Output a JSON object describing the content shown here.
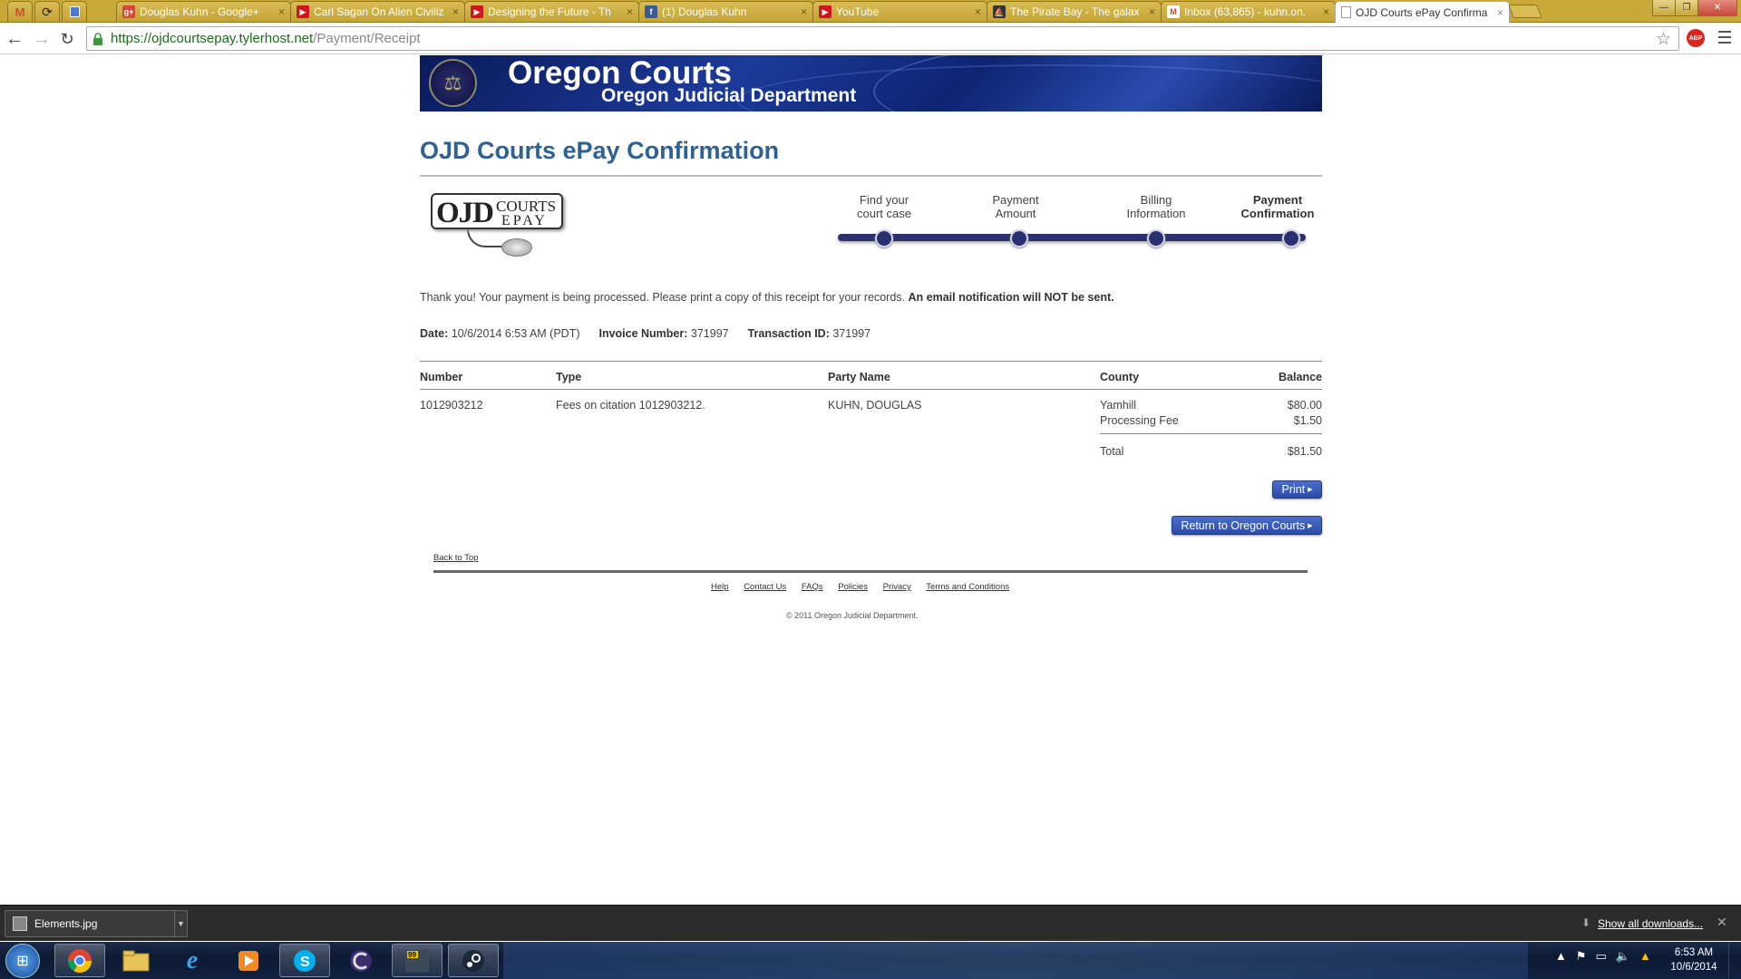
{
  "browser": {
    "pinned_tabs": [
      {
        "icon": "gmail-icon"
      },
      {
        "icon": "chrome-refresh-icon"
      },
      {
        "icon": "docs-icon"
      }
    ],
    "tabs": [
      {
        "title": "Douglas Kuhn - Google+",
        "icon": "googleplus-icon",
        "color": "#d34836"
      },
      {
        "title": "Carl Sagan On Alien Civiliz",
        "icon": "youtube-icon",
        "color": "#cc181e"
      },
      {
        "title": "Designing the Future - Th",
        "icon": "youtube-icon",
        "color": "#cc181e"
      },
      {
        "title": "(1) Douglas Kuhn",
        "icon": "facebook-icon",
        "color": "#3b5998"
      },
      {
        "title": "YouTube",
        "icon": "youtube-icon",
        "color": "#cc181e"
      },
      {
        "title": "The Pirate Bay - The galax",
        "icon": "piratebay-icon",
        "color": "#333333"
      },
      {
        "title": "Inbox (63,865) - kuhn.on.",
        "icon": "gmail-icon",
        "color": "#d14836"
      },
      {
        "title": "OJD Courts ePay Confirma",
        "icon": "page-icon",
        "color": "#ffffff",
        "active": true
      }
    ],
    "url_host": "https://ojdcourtsepay.tylerhost.net",
    "url_path": "/Payment/Receipt",
    "tab_close": "×"
  },
  "banner": {
    "title": "Oregon Courts",
    "subtitle": "Oregon Judicial Department"
  },
  "page_title": "OJD Courts ePay Confirmation",
  "logo": {
    "ojd": "OJD",
    "courts": "COURTS",
    "epay": "EPAY"
  },
  "steps": [
    {
      "line1": "Find your",
      "line2": "court case"
    },
    {
      "line1": "Payment",
      "line2": "Amount"
    },
    {
      "line1": "Billing",
      "line2": "Information"
    },
    {
      "line1": "Payment",
      "line2": "Confirmation",
      "current": true
    }
  ],
  "thanks": {
    "text": "Thank you! Your payment is being processed. Please print a copy of this receipt for your records.",
    "bold": "An email notification will NOT be sent."
  },
  "meta": {
    "date_label": "Date:",
    "date_value": "10/6/2014 6:53 AM (PDT)",
    "invoice_label": "Invoice Number:",
    "invoice_value": "371997",
    "txn_label": "Transaction ID:",
    "txn_value": "371997"
  },
  "table": {
    "headers": {
      "number": "Number",
      "type": "Type",
      "party": "Party Name",
      "county": "County",
      "balance": "Balance"
    },
    "row": {
      "number": "1012903212",
      "type": "Fees on citation 1012903212.",
      "party": "KUHN, DOUGLAS",
      "county": "Yamhill",
      "amount": "$80.00",
      "fee_label": "Processing Fee",
      "fee_amount": "$1.50",
      "total_label": "Total",
      "total_amount": "$81.50"
    }
  },
  "buttons": {
    "print": "Print",
    "return": "Return to Oregon Courts"
  },
  "footer": {
    "back_to_top": "Back to Top",
    "links": [
      "Help",
      "Contact Us",
      "FAQs",
      "Policies",
      "Privacy",
      "Terms and Conditions"
    ],
    "copyright": "© 2011 Oregon Judicial Department."
  },
  "download_shelf": {
    "file": "Elements.jpg",
    "show_all": "Show all downloads..."
  },
  "taskbar": {
    "items": [
      "start-orb",
      "chrome-icon",
      "explorer-folder-icon",
      "internet-explorer-icon",
      "media-player-icon",
      "skype-icon",
      "ccleaner-icon",
      "99-game-icon",
      "steam-icon"
    ],
    "time": "6:53 AM",
    "date": "10/6/2014"
  },
  "colors": {
    "title_blue": "#2e6294",
    "banner_navy": "#1c3a9a",
    "progress_navy": "#2a2f6e",
    "button_blue": "#3a5cb8",
    "tabstrip_gold": "#c9a938"
  }
}
